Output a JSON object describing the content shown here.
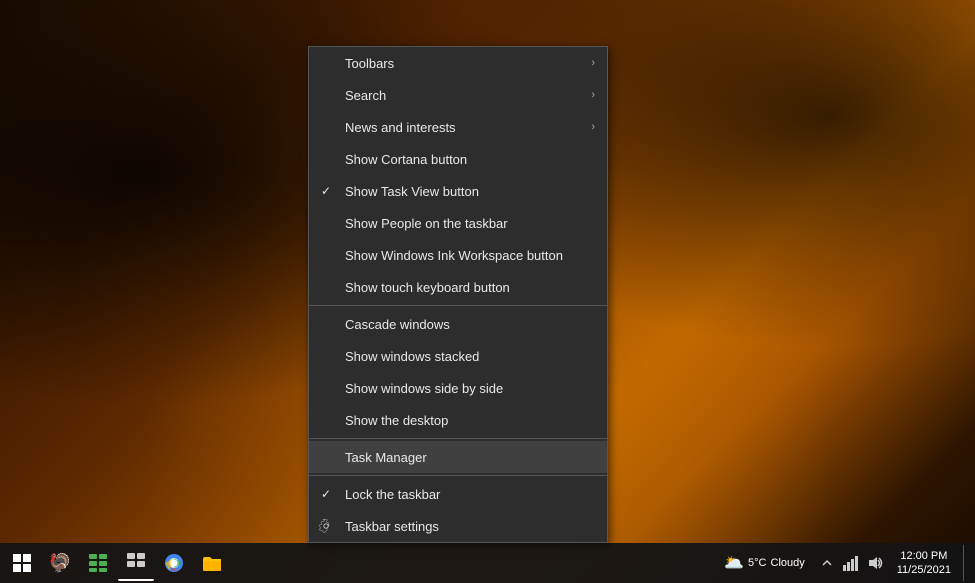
{
  "desktop": {
    "bg_description": "Autumn forest with orange/red leaves"
  },
  "context_menu": {
    "items": [
      {
        "id": "toolbars",
        "label": "Toolbars",
        "has_arrow": true,
        "has_check": false,
        "has_gear": false,
        "divider_after": false
      },
      {
        "id": "search",
        "label": "Search",
        "has_arrow": true,
        "has_check": false,
        "has_gear": false,
        "divider_after": false
      },
      {
        "id": "news",
        "label": "News and interests",
        "has_arrow": true,
        "has_check": false,
        "has_gear": false,
        "divider_after": false
      },
      {
        "id": "cortana",
        "label": "Show Cortana button",
        "has_arrow": false,
        "has_check": false,
        "has_gear": false,
        "divider_after": false
      },
      {
        "id": "taskview",
        "label": "Show Task View button",
        "has_arrow": false,
        "has_check": true,
        "has_gear": false,
        "divider_after": false
      },
      {
        "id": "people",
        "label": "Show People on the taskbar",
        "has_arrow": false,
        "has_check": false,
        "has_gear": false,
        "divider_after": false
      },
      {
        "id": "ink",
        "label": "Show Windows Ink Workspace button",
        "has_arrow": false,
        "has_check": false,
        "has_gear": false,
        "divider_after": false
      },
      {
        "id": "keyboard",
        "label": "Show touch keyboard button",
        "has_arrow": false,
        "has_check": false,
        "has_gear": false,
        "divider_after": true
      },
      {
        "id": "cascade",
        "label": "Cascade windows",
        "has_arrow": false,
        "has_check": false,
        "has_gear": false,
        "divider_after": false
      },
      {
        "id": "stacked",
        "label": "Show windows stacked",
        "has_arrow": false,
        "has_check": false,
        "has_gear": false,
        "divider_after": false
      },
      {
        "id": "side_by_side",
        "label": "Show windows side by side",
        "has_arrow": false,
        "has_check": false,
        "has_gear": false,
        "divider_after": false
      },
      {
        "id": "desktop",
        "label": "Show the desktop",
        "has_arrow": false,
        "has_check": false,
        "has_gear": false,
        "divider_after": true
      },
      {
        "id": "task_manager",
        "label": "Task Manager",
        "has_arrow": false,
        "has_check": false,
        "has_gear": false,
        "divider_after": true
      },
      {
        "id": "lock_taskbar",
        "label": "Lock the taskbar",
        "has_arrow": false,
        "has_check": true,
        "has_gear": false,
        "divider_after": false
      },
      {
        "id": "taskbar_settings",
        "label": "Taskbar settings",
        "has_arrow": false,
        "has_check": false,
        "has_gear": true,
        "divider_after": false
      }
    ]
  },
  "taskbar": {
    "weather": {
      "temp": "5°C",
      "condition": "Cloudy"
    },
    "icons": [
      {
        "id": "start",
        "name": "start-button"
      },
      {
        "id": "taskview",
        "name": "task-view-button"
      },
      {
        "id": "chrome",
        "name": "chrome-icon"
      },
      {
        "id": "explorer",
        "name": "file-explorer-icon"
      }
    ]
  }
}
